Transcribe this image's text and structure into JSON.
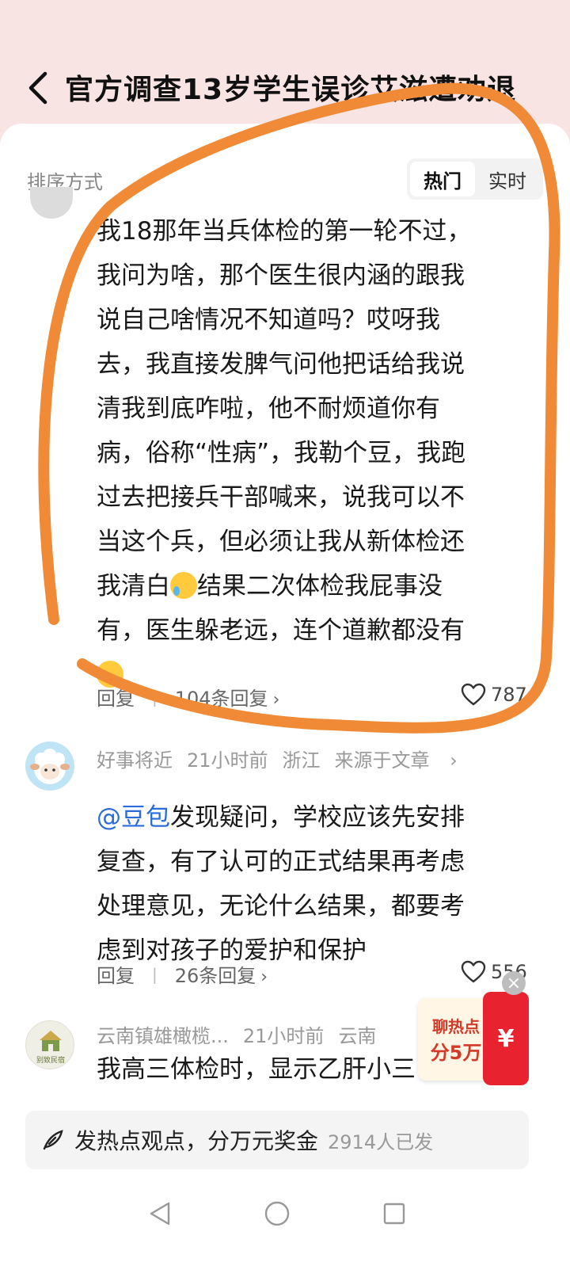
{
  "header": {
    "title": "官方调查13岁学生误诊艾滋遭劝退"
  },
  "sort": {
    "label": "排序方式",
    "options": [
      "热门",
      "实时"
    ],
    "active": "热门"
  },
  "comments": [
    {
      "text_lines": [
        "我18那年当兵体检的第一轮不过，",
        "我问为啥，那个医生很内涵的跟我",
        "说自己啥情况不知道吗？哎呀我",
        "去，我直接发脾气问他把话给我说",
        "清我到底咋啦，他不耐烦道你有",
        "病，俗称“性病”，我勒个豆，我跑",
        "过去把接兵干部喊来，说我可以不",
        "当这个兵，但必须让我从新体检还"
      ],
      "line9_before_emoji": "我清白",
      "line9_after_emoji": "结果二次体检我屁事没",
      "line10": "有，医生躲老远，连个道歉都没有",
      "reply_label": "回复",
      "reply_count": "104条回复",
      "likes": "787",
      "emoji_names": [
        "crying-laughing-emoji",
        "sad-emoji"
      ]
    },
    {
      "user": "好事将近",
      "time": "21小时前",
      "region": "浙江",
      "source": "来源于文章",
      "mention": "@豆包",
      "text_first": "发现疑问，学校应该先安排",
      "text_lines": [
        "复查，有了认可的正式结果再考虑",
        "处理意见，无论什么结果，都要考",
        "虑到对孩子的爱护和保护"
      ],
      "reply_label": "回复",
      "reply_count": "26条回复",
      "likes": "556"
    },
    {
      "user": "云南镇雄橄榄...",
      "time": "21小时前",
      "region": "云南",
      "text": "我高三体检时，显示乙肝小三",
      "avatar_text": "别致民宿"
    }
  ],
  "promo": {
    "line1": "聊热点",
    "line2": "分5万",
    "symbol": "¥"
  },
  "compose": {
    "label": "发热点观点，分万元奖金",
    "count": "2914人已发"
  },
  "colors": {
    "accent_orange": "#f08a36",
    "mention_blue": "#2b6cd8",
    "promo_red": "#e8232f",
    "header_bg": "#f7e4e3"
  }
}
